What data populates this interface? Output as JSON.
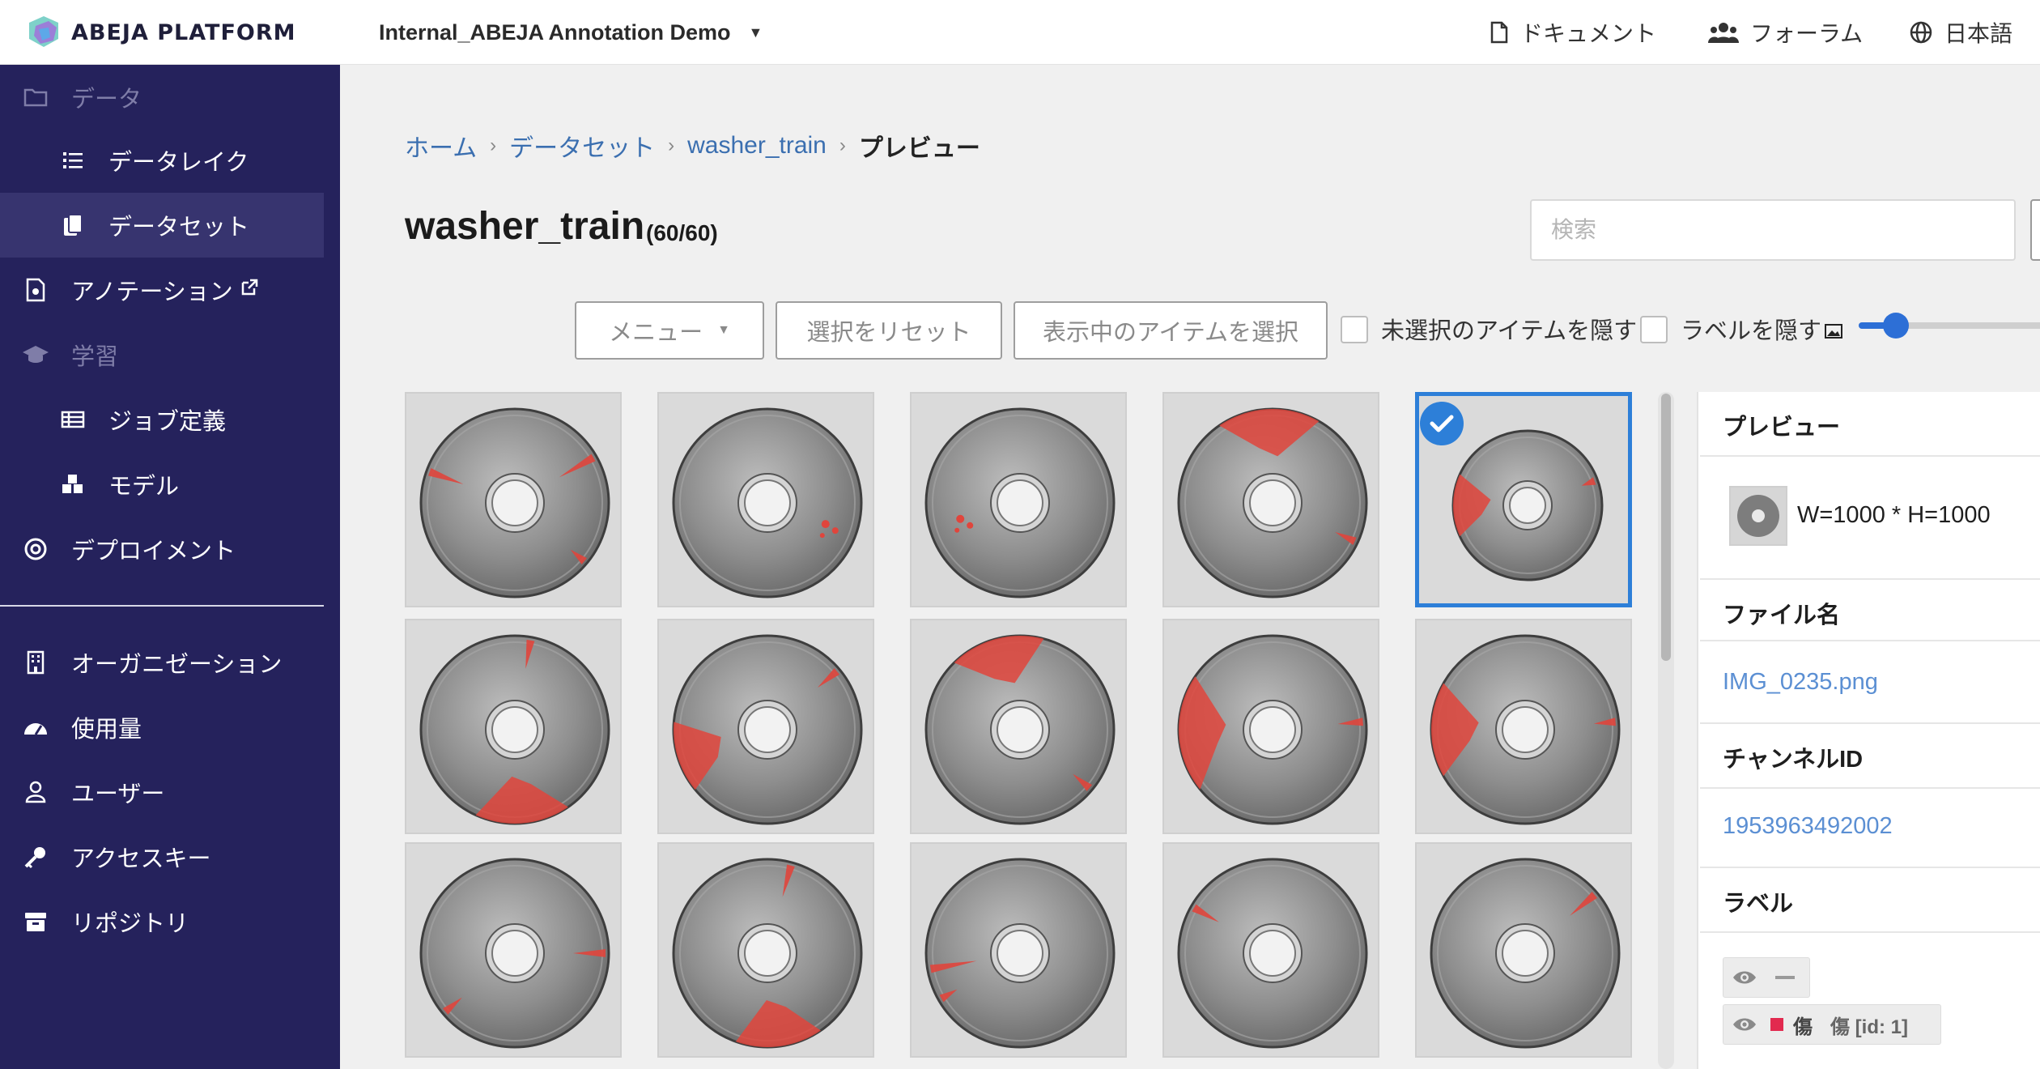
{
  "header": {
    "brand": "ABEJA PLATFORM",
    "project": "Internal_ABEJA Annotation Demo",
    "links": {
      "docs": "ドキュメント",
      "forum": "フォーラム",
      "language": "日本語"
    }
  },
  "sidebar": {
    "data_section": "データ",
    "datalake": "データレイク",
    "dataset": "データセット",
    "annotation": "アノテーション",
    "learning_section": "学習",
    "job_definition": "ジョブ定義",
    "model": "モデル",
    "deployment": "デプロイメント",
    "organization": "オーガニゼーション",
    "usage": "使用量",
    "user": "ユーザー",
    "access_key": "アクセスキー",
    "repository": "リポジトリ"
  },
  "breadcrumb": {
    "home": "ホーム",
    "datasets": "データセット",
    "dataset": "washer_train",
    "current": "プレビュー"
  },
  "page": {
    "title": "washer_train",
    "count": "(60/60)",
    "search_placeholder": "検索"
  },
  "toolbar": {
    "menu": "メニュー",
    "reset_selection": "選択をリセット",
    "select_visible": "表示中のアイテムを選択",
    "hide_unselected": "未選択のアイテムを隠す",
    "hide_labels": "ラベルを隠す",
    "thumbnail_size": 0.2
  },
  "grid": {
    "selected_index": 4,
    "tiles": [
      {
        "defects": [
          {
            "type": "crack",
            "a": 200,
            "len": 0.55
          },
          {
            "type": "crack",
            "a": 330,
            "len": 0.6
          },
          {
            "type": "crack",
            "a": 40,
            "len": 0.3
          }
        ]
      },
      {
        "defects": [
          {
            "type": "spot",
            "a": 20,
            "r": 0.55
          }
        ]
      },
      {
        "defects": [
          {
            "type": "spot",
            "a": 165,
            "r": 0.55
          }
        ]
      },
      {
        "defects": [
          {
            "type": "blob",
            "a0": 235,
            "a1": 300
          },
          {
            "type": "crack",
            "a": 25,
            "len": 0.35
          }
        ]
      },
      {
        "defects": [
          {
            "type": "blob",
            "a0": 155,
            "a1": 205
          },
          {
            "type": "crack",
            "a": 340,
            "len": 0.3
          }
        ]
      },
      {
        "defects": [
          {
            "type": "crack",
            "a": 280,
            "len": 0.45
          },
          {
            "type": "blob",
            "a0": 55,
            "a1": 115
          }
        ]
      },
      {
        "defects": [
          {
            "type": "crack",
            "a": 320,
            "len": 0.4
          },
          {
            "type": "blob",
            "a0": 140,
            "a1": 185
          }
        ]
      },
      {
        "defects": [
          {
            "type": "blob",
            "a0": 225,
            "a1": 285
          },
          {
            "type": "crack",
            "a": 40,
            "len": 0.35
          }
        ]
      },
      {
        "defects": [
          {
            "type": "blob",
            "a0": 140,
            "a1": 215
          },
          {
            "type": "crack",
            "a": 355,
            "len": 0.4
          }
        ]
      },
      {
        "defects": [
          {
            "type": "blob",
            "a0": 150,
            "a1": 210
          },
          {
            "type": "crack",
            "a": 355,
            "len": 0.35
          }
        ]
      },
      {
        "defects": [
          {
            "type": "crack",
            "a": 0,
            "len": 0.5
          },
          {
            "type": "crack",
            "a": 140,
            "len": 0.35
          }
        ]
      },
      {
        "defects": [
          {
            "type": "crack",
            "a": 285,
            "len": 0.5
          },
          {
            "type": "blob",
            "a0": 55,
            "a1": 110
          }
        ]
      },
      {
        "defects": [
          {
            "type": "crack",
            "a": 170,
            "len": 0.7
          },
          {
            "type": "crack",
            "a": 150,
            "len": 0.3
          }
        ]
      },
      {
        "defects": [
          {
            "type": "crack",
            "a": 210,
            "len": 0.45
          }
        ]
      },
      {
        "defects": [
          {
            "type": "crack",
            "a": 320,
            "len": 0.5
          }
        ]
      }
    ]
  },
  "preview": {
    "title": "プレビュー",
    "dimensions": "W=1000 * H=1000",
    "file_name_label": "ファイル名",
    "file_name": "IMG_0235.png",
    "channel_label": "チャンネルID",
    "channel_id": "1953963492002",
    "label_heading": "ラベル",
    "label_name": "傷",
    "label_detail": "傷 [id: 1]",
    "label_color": "#e22a4f"
  },
  "colors": {
    "sidebar_bg": "#25225c",
    "accent": "#2d7fd8",
    "link": "#5b8fd3",
    "defect": "#e0453c"
  }
}
